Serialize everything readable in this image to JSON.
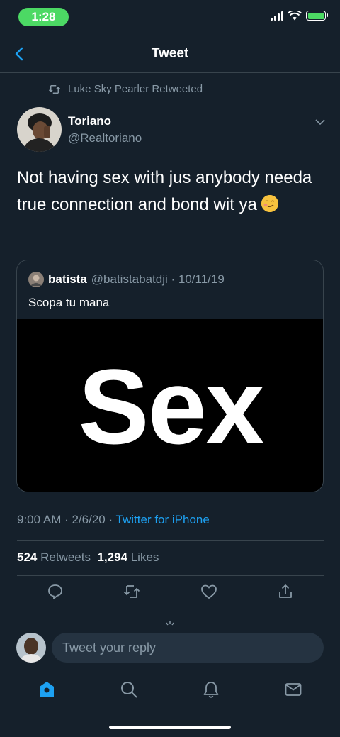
{
  "status": {
    "time": "1:28"
  },
  "nav": {
    "title": "Tweet"
  },
  "retweet_context": "Luke Sky Pearler Retweeted",
  "tweet": {
    "name": "Toriano",
    "handle": "@Realtoriano",
    "text": "Not having sex with jus anybody needa true connection and bond wit ya",
    "emoji": "smirking-face",
    "timestamp": "9:00 AM · 2/6/20 · ",
    "source": "Twitter for iPhone",
    "retweets_count": "524",
    "retweets_label": "Retweets",
    "likes_count": "1,294",
    "likes_label": "Likes"
  },
  "quote": {
    "name": "batista",
    "handle_date": "@batistabatdji · 10/11/19",
    "text": "Scopa tu mana",
    "media_text": "Sex"
  },
  "reply": {
    "placeholder": "Tweet your reply"
  },
  "colors": {
    "bg": "#15202b",
    "accent": "#1da1f2",
    "muted": "#8899a6",
    "border": "#38444d"
  }
}
